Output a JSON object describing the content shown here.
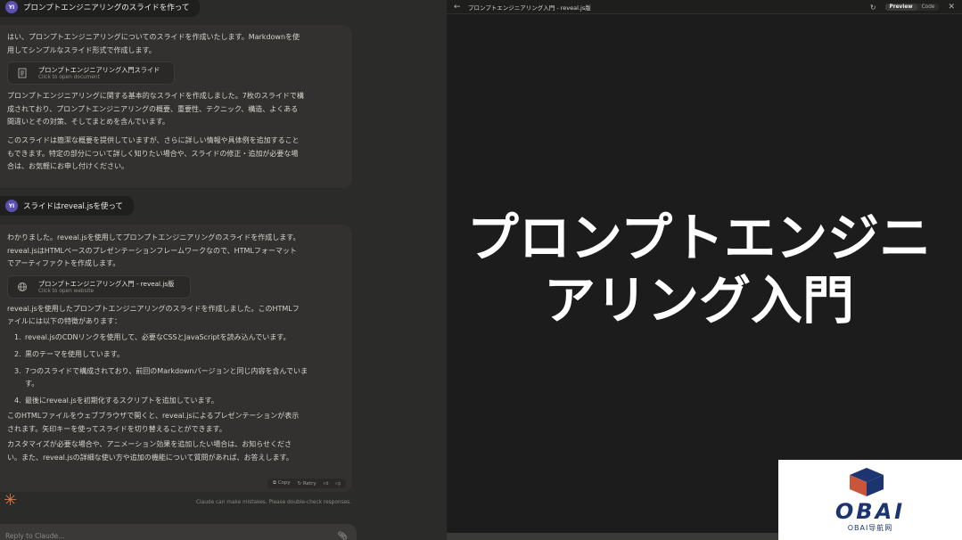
{
  "chat": {
    "user1": {
      "initials": "YI",
      "text": "プロンプトエンジニアリングのスライドを作って"
    },
    "reply1": {
      "intro_l1": "はい、プロンプトエンジニアリングについてのスライドを作成いたします。Markdownを使",
      "intro_l2": "用してシンプルなスライド形式で作成します。",
      "artifact": {
        "icon": "document-icon",
        "title": "プロンプトエンジニアリング入門スライド",
        "subtitle": "Click to open document"
      },
      "p2_l1": "プロンプトエンジニアリングに関する基本的なスライドを作成しました。7枚のスライドで構",
      "p2_l2": "成されており、プロンプトエンジニアリングの概要、重要性、テクニック、構造、よくある",
      "p2_l3": "間違いとその対策、そしてまとめを含んでいます。",
      "p3_l1": "このスライドは簡潔な概要を提供していますが、さらに詳しい情報や具体例を追加すること",
      "p3_l2": "もできます。特定の部分について詳しく知りたい場合や、スライドの修正・追加が必要な場",
      "p3_l3": "合は、お気軽にお申し付けください。"
    },
    "user2": {
      "initials": "YI",
      "text": "スライドはreveal.jsを使って"
    },
    "reply2": {
      "intro_l1": "わかりました。reveal.jsを使用してプロンプトエンジニアリングのスライドを作成します。",
      "intro_l2": "reveal.jsはHTMLベースのプレゼンテーションフレームワークなので、HTMLフォーマット",
      "intro_l3": "でアーティファクトを作成します。",
      "artifact": {
        "icon": "globe-icon",
        "title": "プロンプトエンジニアリング入門 - reveal.js版",
        "subtitle": "Click to open website"
      },
      "p2_l1": "reveal.jsを使用したプロンプトエンジニアリングのスライドを作成しました。このHTMLフ",
      "p2_l2": "ァイルには以下の特徴があります：",
      "items": [
        {
          "n": "1.",
          "l1": "reveal.jsのCDNリンクを使用して、必要なCSSとJavaScriptを読み込んでいます。",
          "l2": ""
        },
        {
          "n": "2.",
          "l1": "黒のテーマを使用しています。",
          "l2": ""
        },
        {
          "n": "3.",
          "l1": "7つのスライドで構成されており、前回のMarkdownバージョンと同じ内容を含んでいま",
          "l2": "す。"
        },
        {
          "n": "4.",
          "l1": "最後にreveal.jsを初期化するスクリプトを追加しています。",
          "l2": ""
        }
      ],
      "p3_l1": "このHTMLファイルをウェブブラウザで開くと、reveal.jsによるプレゼンテーションが表示",
      "p3_l2": "されます。矢印キーを使ってスライドを切り替えることができます。",
      "p4_l1": "カスタマイズが必要な場合や、アニメーション効果を追加したい場合は、お知らせくださ",
      "p4_l2": "い。また、reveal.jsの詳細な使い方や追加の機能について質問があれば、お答えします。"
    },
    "actions": {
      "copy": "Copy",
      "retry": "Retry"
    },
    "disclaimer": "Claude can make mistakes. Please double-check responses.",
    "input_placeholder": "Reply to Claude..."
  },
  "preview": {
    "title": "プロンプトエンジニアリング入門 - reveal.js版",
    "preview_tab": "Preview",
    "code_tab": "Code",
    "slide_line1": "プロンプトエンジニ",
    "slide_line2": "アリング入門"
  },
  "watermark": {
    "brand": "OBAI",
    "sub": "OBAI导航网"
  }
}
